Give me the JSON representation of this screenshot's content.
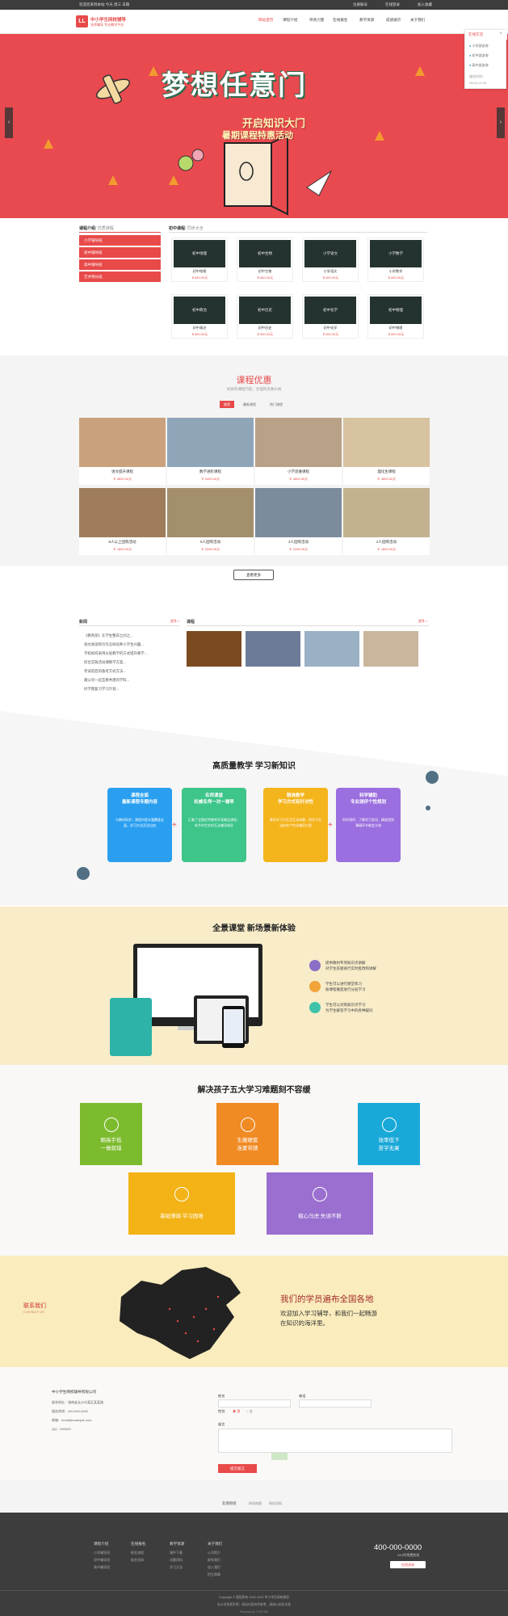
{
  "topbar": {
    "left": "欢迎您来到本站 今天 周三 日期",
    "links": [
      "注册账号",
      "在线登录",
      "加入收藏"
    ]
  },
  "logo": {
    "mark": "LL",
    "name": "中小学生网校辅导",
    "slogan": "名师辅导 专业教学平台"
  },
  "nav": [
    "网站首页",
    "课程介绍",
    "师资力量",
    "在线报名",
    "教学资源",
    "成绩展示",
    "关于我们"
  ],
  "float_panel": {
    "title": "在线交流",
    "items": [
      "小学部咨询",
      "初中部咨询",
      "高中部咨询"
    ],
    "hours_label": "服务时间：",
    "hours": "09:00-21:00"
  },
  "banner": {
    "title": "梦想任意门",
    "line1": "开启知识大门",
    "line2": "暑期课程特惠活动"
  },
  "side": {
    "head": "课程介绍",
    "sub": "/ 优质课程",
    "items": [
      "小学辅导班",
      "初中辅导班",
      "高中辅导班",
      "艺术特长班"
    ]
  },
  "courses": {
    "head": "初中课程",
    "sub": "/ 同步大全",
    "items": [
      {
        "img": "初中地理",
        "name": "初中地理",
        "price": "￥400.00元"
      },
      {
        "img": "初中生物",
        "name": "初中生物",
        "price": "￥400.00元"
      },
      {
        "img": "小学语文",
        "name": "小学语文",
        "price": "￥400.00元"
      },
      {
        "img": "小学数学",
        "name": "小学数学",
        "price": "￥400.00元"
      },
      {
        "img": "初中政治",
        "name": "初中政治",
        "price": "￥400.00元"
      },
      {
        "img": "初中历史",
        "name": "初中历史",
        "price": "￥400.00元"
      },
      {
        "img": "初中化学",
        "name": "初中化学",
        "price": "￥400.00元"
      },
      {
        "img": "初中物理",
        "name": "初中物理",
        "price": "￥400.00元"
      }
    ]
  },
  "promo": {
    "title": "课程优惠",
    "sub": "优质的课程内容，合理的优惠价格",
    "tabs": [
      "推荐",
      "最新课程",
      "热门课程"
    ],
    "more": "查看更多",
    "items": [
      {
        "name": "语文提升课程",
        "price": "￥ 9600.00元"
      },
      {
        "name": "数学进阶课程",
        "price": "￥ 5400.00元"
      },
      {
        "name": "小学思维课程",
        "price": "￥ 4800.00元"
      },
      {
        "name": "理化生课程",
        "price": "￥ 4800.00元"
      },
      {
        "name": "8人以上团购活动",
        "price": "￥ 1800.00元"
      },
      {
        "name": "5人团购活动",
        "price": "￥ 2096.00元"
      },
      {
        "name": "3人团购活动",
        "price": "￥ 2436.00元"
      },
      {
        "name": "2人团购活动",
        "price": "￥ 1800.00元"
      }
    ]
  },
  "news": {
    "head": "新闻",
    "more": "更多 >",
    "items": [
      "《教育部》在学生整日之间之...",
      "语文阅读和写作怎样培养小学生兴趣...",
      "学校如何采用分层教学的方式提升教学...",
      "综合实践活动课教学方案...",
      "考试前后的备考方式方法...",
      "跟父母一起互教共建的学科...",
      "好学期复习学习计划..."
    ]
  },
  "photos": {
    "head": "课程",
    "more": "更多 >"
  },
  "feature": {
    "title": "高质量教学  学习新知识",
    "cards": [
      {
        "t": "课程全面\n最新课程专题内容",
        "d": "与教材同步，课程内容丰富覆盖全面，学习方式灵活自由"
      },
      {
        "t": "名师课堂\n权威名师一对一辅导",
        "d": "汇聚了全国优秀教师开发精品课程，给予学生实时互动辅导指导"
      },
      {
        "t": "精准教学\n学习方式有针对性",
        "d": "教学学习与生活互动场景，把学习方法结合个性化辅导方案"
      },
      {
        "t": "科学辅助\n专业测评个性规划",
        "d": "科学测评，了解学习状况，精准找到薄弱环节制定计划"
      }
    ]
  },
  "panorama": {
    "title": "全景课堂  新场景新体验",
    "points": [
      "提供教材专项知识点讲解\n对学生答题进行实时批改和讲解",
      "学生可以进行随堂练习\n按课程难度进行分层学习",
      "学生可以对照知识点学习\n为学生解答学习中的各种疑问"
    ]
  },
  "problems": {
    "title": "解决孩子五大学习难题刻不容缓",
    "items": [
      "眼高手低\n一做就错",
      "生搬硬套\n连蒙带猜",
      "效率低下\n苦学无果",
      "基础薄弱 学习困难",
      "粗心马虎 失误不断"
    ]
  },
  "mapsec": {
    "contact": "联系我们",
    "contact_en": "CONTACT US",
    "headline": "我们的学员遍布全国各地",
    "desc": "欢迎加入学习辅导，和我们一起畅游\n在知识的海洋里。"
  },
  "contact": {
    "company": "中小学生网校辅导有限公司",
    "addr": "联系地址：湖南省长沙市某区某某路",
    "phone": "服务热线：400-000-0000",
    "email": "邮箱：email@example.com",
    "qq": "QQ：000000",
    "form": {
      "name": "姓名",
      "tel": "电话",
      "gender": "性别",
      "male": "男",
      "female": "女",
      "content": "留言",
      "submit": "提交留言"
    }
  },
  "links": {
    "head": "友情链接",
    "items": [
      "网站地图",
      "网站导航"
    ]
  },
  "footer": {
    "cols": [
      {
        "h": "课程介绍",
        "items": [
          "小学辅导班",
          "初中辅导班",
          "高中辅导班"
        ]
      },
      {
        "h": "在线报名",
        "items": [
          "报名流程",
          "报名须知"
        ]
      },
      {
        "h": "教学资源",
        "items": [
          "课件下载",
          "试题资料",
          "学习方法"
        ]
      },
      {
        "h": "关于我们",
        "items": [
          "公司简介",
          "联系我们",
          "加入我们",
          "招生简章"
        ]
      }
    ],
    "phone": "400-000-0000",
    "phone_label": "24小时免费热线",
    "btn": "在线咨询",
    "copy": "Copyright © 版权所有 2000-2022 中小学生网校辅导",
    "note": "本公司免责声明：网站内容仅供参考，具体以实际为准",
    "powered": "Powered by TOPCMS"
  }
}
